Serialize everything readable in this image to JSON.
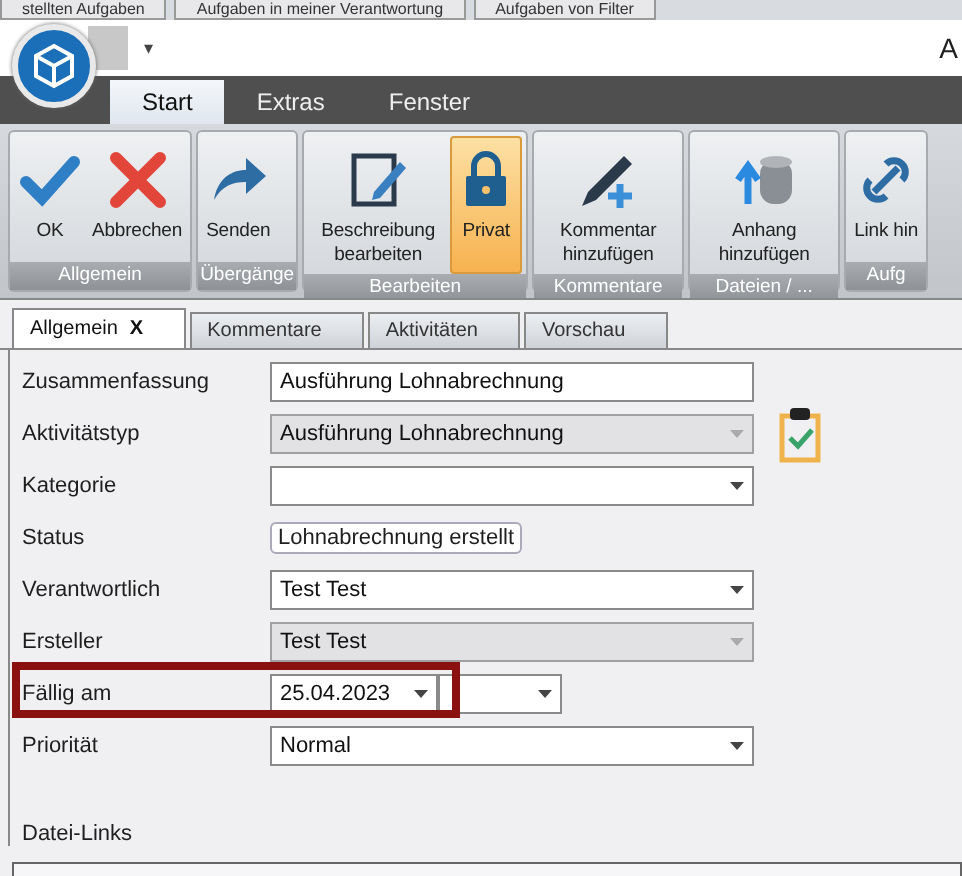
{
  "background_tabs": [
    "stellten Aufgaben",
    "Aufgaben in meiner Verantwortung",
    "Aufgaben von Filter"
  ],
  "title_bar": {
    "quick_access": "▾",
    "title": "A"
  },
  "ribbon_tabs": [
    {
      "label": "Start",
      "selected": true
    },
    {
      "label": "Extras",
      "selected": false
    },
    {
      "label": "Fenster",
      "selected": false
    }
  ],
  "ribbon_groups": [
    {
      "label": "Allgemein",
      "buttons": [
        {
          "kind": "check",
          "label": "OK",
          "selected": false
        },
        {
          "kind": "cross",
          "label": "Abbrechen",
          "selected": false
        }
      ]
    },
    {
      "label": "Übergänge",
      "buttons": [
        {
          "kind": "send",
          "label": "Senden",
          "selected": false
        }
      ]
    },
    {
      "label": "Bearbeiten",
      "buttons": [
        {
          "kind": "edit",
          "label": "Beschreibung bearbeiten",
          "selected": false
        },
        {
          "kind": "lock",
          "label": "Privat",
          "selected": true
        }
      ]
    },
    {
      "label": "Kommentare",
      "buttons": [
        {
          "kind": "pen",
          "label": "Kommentar hinzufügen",
          "selected": false
        }
      ]
    },
    {
      "label": "Dateien / ...",
      "buttons": [
        {
          "kind": "database",
          "label": "Anhang hinzufügen",
          "selected": false
        }
      ]
    },
    {
      "label": "Aufg",
      "buttons": [
        {
          "kind": "link",
          "label": "Link hin",
          "selected": false
        }
      ]
    }
  ],
  "doc_tabs": [
    {
      "label": "Allgemein",
      "selected": true,
      "close": "X"
    },
    {
      "label": "Kommentare",
      "selected": false
    },
    {
      "label": "Aktivitäten",
      "selected": false
    },
    {
      "label": "Vorschau",
      "selected": false
    }
  ],
  "form": [
    {
      "kind": "text",
      "label": "Zusammenfassung",
      "value": "Ausführung Lohnabrechnung",
      "highlighted": false
    },
    {
      "kind": "dropdown",
      "label": "Aktivitätstyp",
      "value": "Ausführung Lohnabrechnung",
      "disabled": true,
      "highlighted": false
    },
    {
      "kind": "dropdown",
      "label": "Kategorie",
      "disabled": false,
      "highlighted": false
    },
    {
      "kind": "tag",
      "label": "Status",
      "value": "Lohnabrechnung erstellt",
      "highlighted": false
    },
    {
      "kind": "dropdown",
      "label": "Verantwortlich",
      "value": "Test Test",
      "disabled": false,
      "highlighted": false
    },
    {
      "kind": "dropdown",
      "label": "Ersteller",
      "value": "Test Test",
      "disabled": true,
      "highlighted": false
    },
    {
      "kind": "date",
      "label": "Fällig am",
      "value": "25.04.2023",
      "disabled": false,
      "highlighted": true
    },
    {
      "kind": "dropdown",
      "label": "Priorität",
      "value": "Normal",
      "disabled": false,
      "highlighted": false
    }
  ],
  "files_section": {
    "label": "Datei-Links"
  }
}
